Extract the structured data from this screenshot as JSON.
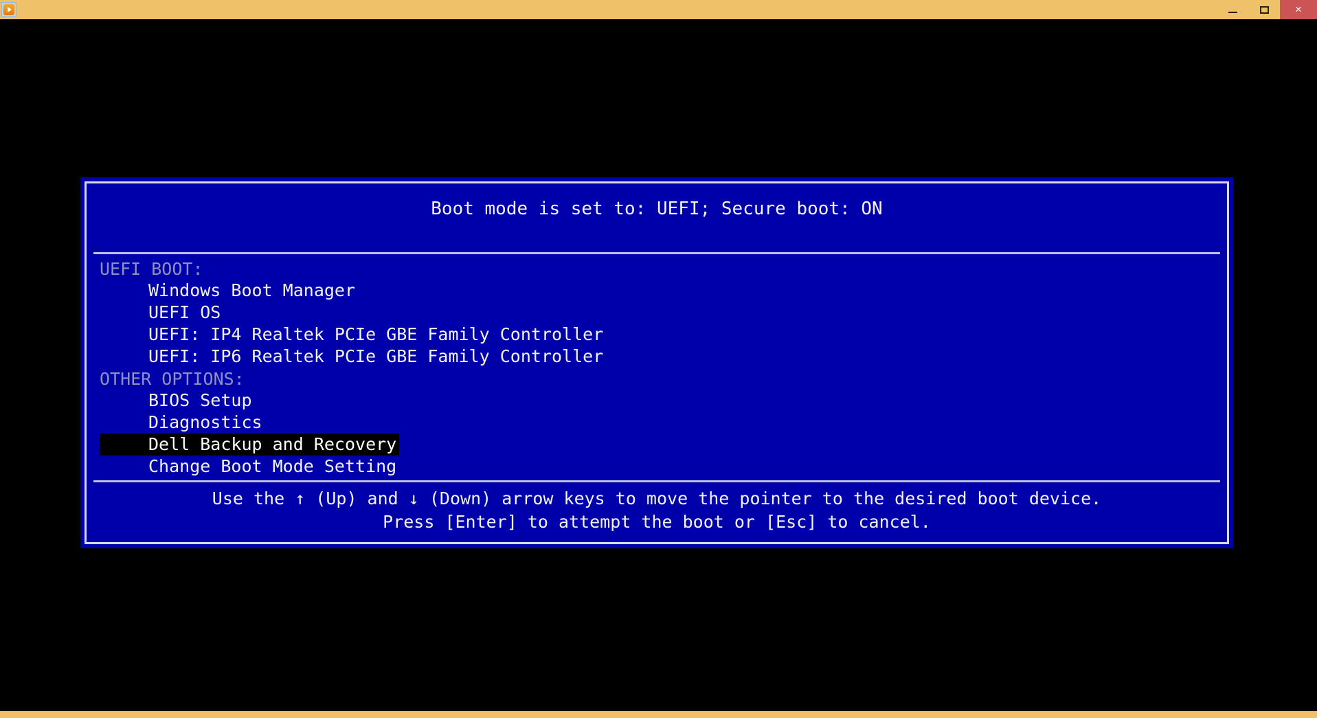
{
  "window": {
    "title": "",
    "app_icon": "media-play-icon",
    "titlebar_color": "#efc269",
    "controls": {
      "minimize_label": "",
      "maximize_label": "",
      "close_label": "×"
    }
  },
  "boot_menu": {
    "title": "Boot mode is set to: UEFI; Secure boot: ON",
    "background_color": "#0000aa",
    "border_color": "#d8d8f0",
    "text_color": "#f2f2f2",
    "section_header_color": "#8f8fc8",
    "highlight_background": "#000000",
    "sections": [
      {
        "header": "UEFI BOOT:",
        "items": [
          {
            "label": "Windows Boot Manager",
            "selected": false
          },
          {
            "label": "UEFI OS",
            "selected": false
          },
          {
            "label": "UEFI: IP4 Realtek PCIe GBE Family Controller",
            "selected": false
          },
          {
            "label": "UEFI: IP6 Realtek PCIe GBE Family Controller",
            "selected": false
          }
        ]
      },
      {
        "header": "OTHER OPTIONS:",
        "items": [
          {
            "label": "BIOS Setup",
            "selected": false
          },
          {
            "label": "Diagnostics",
            "selected": false
          },
          {
            "label": "Dell Backup and Recovery",
            "selected": true
          },
          {
            "label": "Change Boot Mode Setting",
            "selected": false
          }
        ]
      }
    ],
    "footer": {
      "line1": "Use the ↑ (Up) and ↓ (Down) arrow keys to move the pointer to the desired boot device.",
      "line2": "Press [Enter] to attempt the boot or [Esc] to cancel."
    }
  }
}
